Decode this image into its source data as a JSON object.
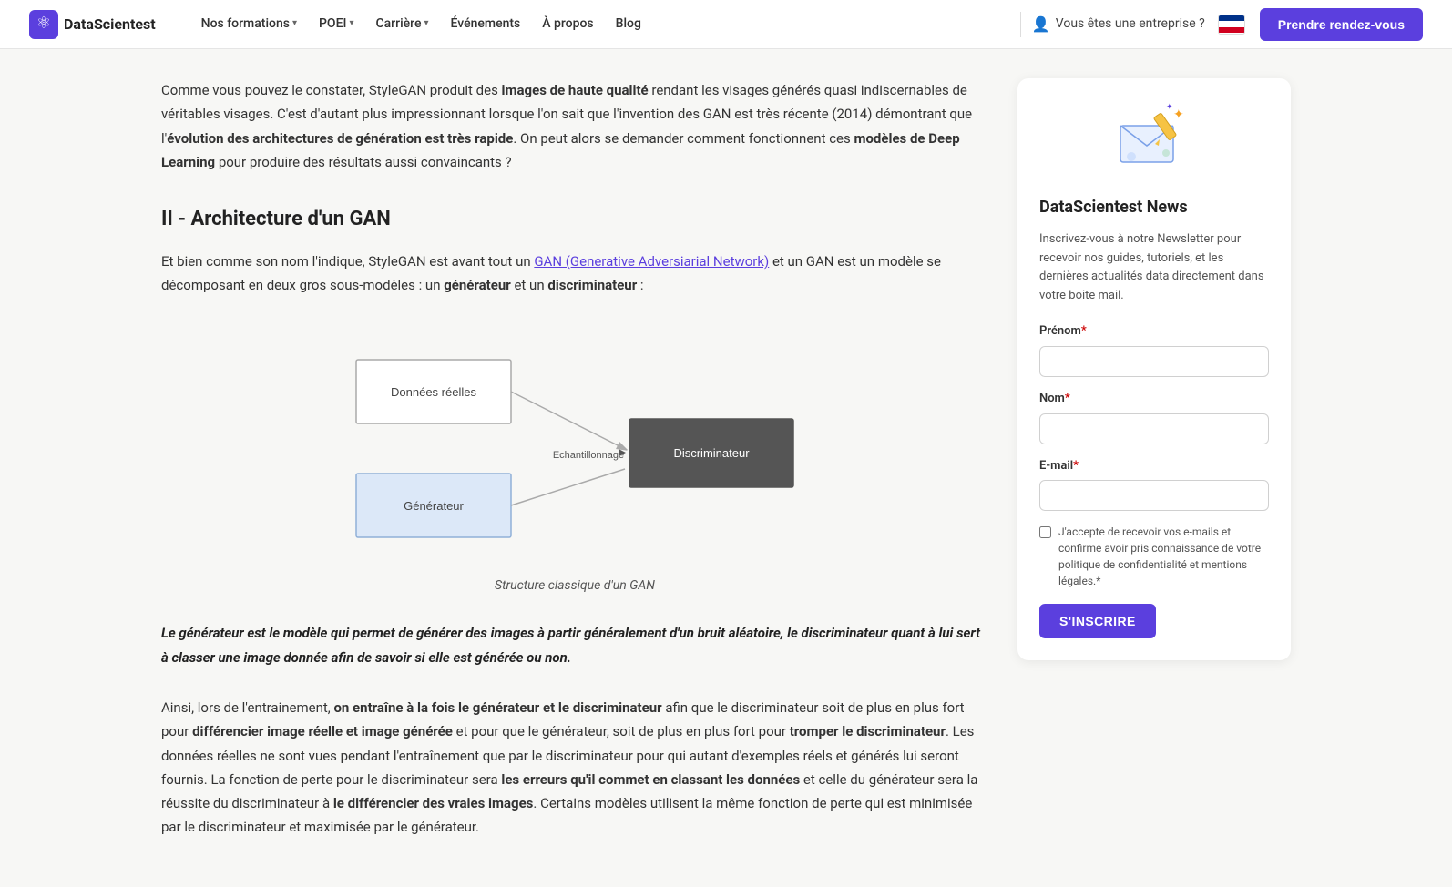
{
  "nav": {
    "logo_text": "DataScientest",
    "items": [
      {
        "label": "Nos formations",
        "has_dropdown": true
      },
      {
        "label": "POEI",
        "has_dropdown": true
      },
      {
        "label": "Carrière",
        "has_dropdown": true
      },
      {
        "label": "Événements",
        "has_dropdown": false
      },
      {
        "label": "À propos",
        "has_dropdown": false
      },
      {
        "label": "Blog",
        "has_dropdown": false
      }
    ],
    "enterprise_label": "Vous êtes une entreprise ?",
    "cta_label": "Prendre rendez-vous"
  },
  "article": {
    "intro_p1": "Comme vous pouvez le constater, StyleGAN produit des ",
    "intro_bold1": "images de haute qualité",
    "intro_p2": " rendant les visages générés quasi indiscernables de véritables visages. C'est d'autant plus impressionnant lorsque l'on sait que l'invention des GAN est très récente (2014) démontrant que l'",
    "intro_bold2": "évolution des architectures de génération est très rapide",
    "intro_p3": ". On peut alors se demander comment fonctionnent ces ",
    "intro_bold3": "modèles de Deep Learning",
    "intro_p4": " pour produire des résultats aussi convaincants ?",
    "section_heading": "II - Architecture d'un GAN",
    "section_intro_p1": "Et bien comme son nom l'indique, StyleGAN est avant tout un ",
    "section_link_text": "GAN (Generative Adversiarial Network)",
    "section_link_href": "#",
    "section_intro_p2": " et un GAN est un modèle se décomposant en deux gros sous-modèles : un ",
    "section_bold1": "générateur",
    "section_intro_p3": " et un ",
    "section_bold2": "discriminateur",
    "section_intro_p4": " :",
    "diagram_caption": "Structure classique d'un GAN",
    "diagram": {
      "box_donnees_label": "Données réelles",
      "box_generateur_label": "Générateur",
      "box_discriminateur_label": "Discriminateur",
      "arrow_label": "Echantillonnage"
    },
    "quote": "Le générateur est le modèle qui permet de générer des images à partir généralement d'un bruit aléatoire, le discriminateur quant à lui sert à classer une image donnée afin de savoir si elle est générée ou non.",
    "body_p1_before": "Ainsi, lors de l'entrainement, ",
    "body_p1_bold1": "on entraîne à la fois le générateur et le discriminateur",
    "body_p1_mid1": " afin que le discriminateur soit de plus en plus fort pour ",
    "body_p1_bold2": "différencier image réelle et image générée",
    "body_p1_mid2": " et pour que le générateur, soit de plus en plus fort pour ",
    "body_p1_bold3": "tromper le discriminateur",
    "body_p1_end": ". Les données réelles ne sont vues pendant l'entraînement que par le discriminateur pour qui autant d'exemples réels et générés lui seront fournis. La fonction de perte pour le discriminateur sera ",
    "body_p1_bold4": "les erreurs qu'il commet en classant les données",
    "body_p1_end2": " et celle du générateur sera la réussite du discriminateur à ",
    "body_p1_bold5": "le différencier des vraies images",
    "body_p1_final": ". Certains modèles utilisent la même fonction de perte qui est minimisée par le discriminateur et maximisée par le générateur."
  },
  "sidebar": {
    "title": "DataScientest News",
    "description": "Inscrivez-vous à notre Newsletter pour recevoir nos guides, tutoriels, et les dernières actualités data directement dans votre boite mail.",
    "form": {
      "prenom_label": "Prénom",
      "prenom_required": "*",
      "nom_label": "Nom",
      "nom_required": "*",
      "email_label": "E-mail",
      "email_required": "*",
      "checkbox_text": "J'accepte de recevoir vos e-mails et confirme avoir pris connaissance de votre politique de confidentialité et mentions légales.",
      "checkbox_required": "*",
      "submit_label": "S'INSCRIRE"
    }
  }
}
